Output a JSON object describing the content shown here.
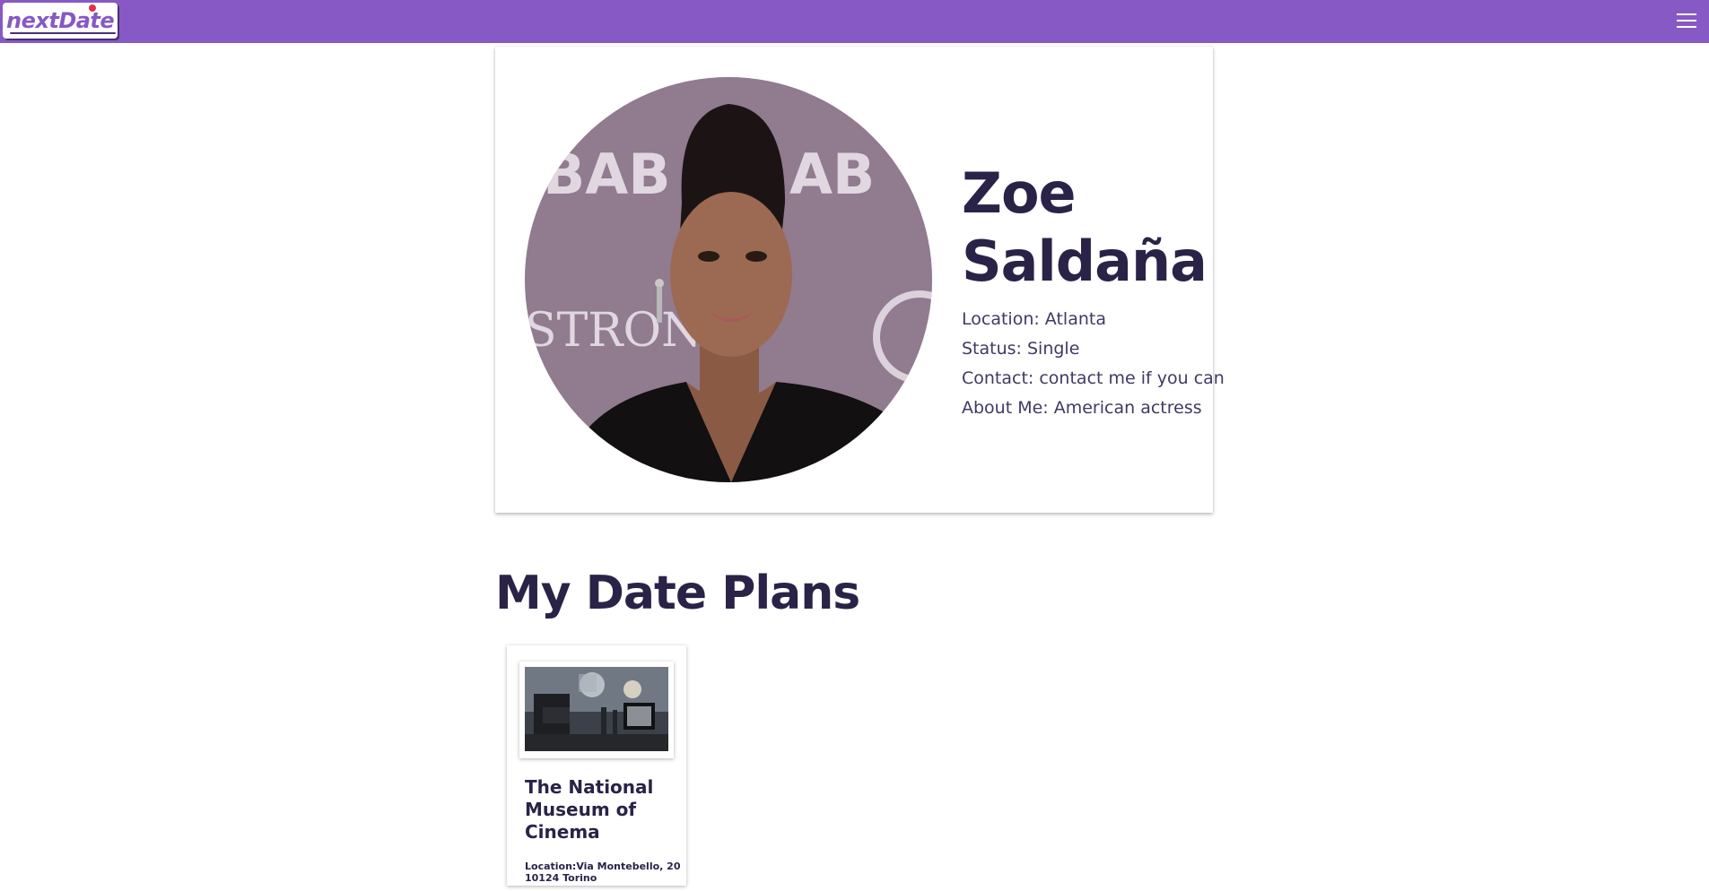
{
  "navbar": {
    "logo_text": "nextDate",
    "menu_icon": "hamburger-menu-icon",
    "background_color": "#8659c4"
  },
  "profile": {
    "name": "Zoe Saldaña",
    "photo_icon": "profile-photo",
    "details": [
      "Location: Atlanta",
      "Status: Single",
      "Contact: contact me if you can",
      "About Me: American actress"
    ]
  },
  "plans": {
    "title": "My Date Plans",
    "items": [
      {
        "title": "The National Museum of Cinema",
        "location": "Location:Via Montebello, 20 10124 Torino",
        "image_icon": "cinema-photo"
      }
    ]
  },
  "colors": {
    "accent": "#8659c4",
    "heading": "#2a2347",
    "text": "#3f3a63"
  }
}
